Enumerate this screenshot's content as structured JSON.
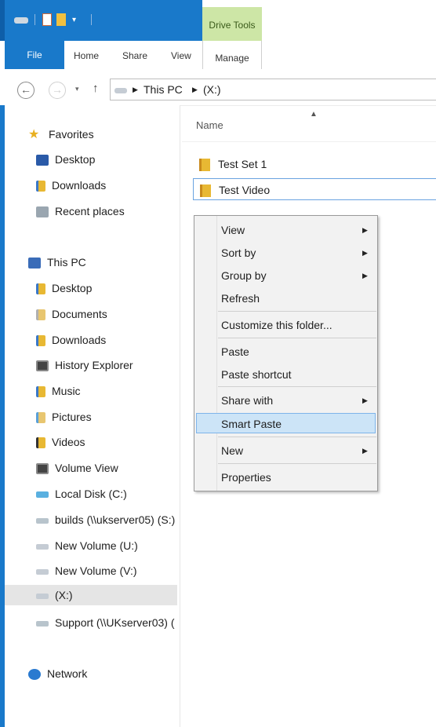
{
  "ribbon": {
    "contextual_group": "Drive Tools",
    "tabs": [
      "File",
      "Home",
      "Share",
      "View",
      "Manage"
    ]
  },
  "address": {
    "path": [
      "This PC",
      "(X:)"
    ]
  },
  "navigation": {
    "favorites": {
      "label": "Favorites",
      "items": [
        "Desktop",
        "Downloads",
        "Recent places"
      ]
    },
    "this_pc": {
      "label": "This PC",
      "items": [
        "Desktop",
        "Documents",
        "Downloads",
        "History Explorer",
        "Music",
        "Pictures",
        "Videos",
        "Volume View",
        "Local Disk (C:)",
        "builds (\\\\ukserver05) (S:)",
        "New Volume (U:)",
        "New Volume (V:)",
        "(X:)",
        "Support (\\\\UKserver03) ("
      ],
      "selected": "(X:)"
    },
    "network": {
      "label": "Network"
    }
  },
  "content": {
    "column_header": "Name",
    "items": [
      "Test Set 1",
      "Test Video"
    ]
  },
  "context_menu": {
    "items": [
      "View",
      "Sort by",
      "Group by",
      "Refresh",
      "Customize this folder...",
      "Paste",
      "Paste shortcut",
      "Share with",
      "Smart Paste",
      "New",
      "Properties"
    ],
    "highlighted": "Smart Paste"
  },
  "colors": {
    "accent": "#1979ca",
    "drive_tools": "#cde6a6",
    "menu_highlight": "#cce4f7",
    "folder": "#e8b833"
  }
}
